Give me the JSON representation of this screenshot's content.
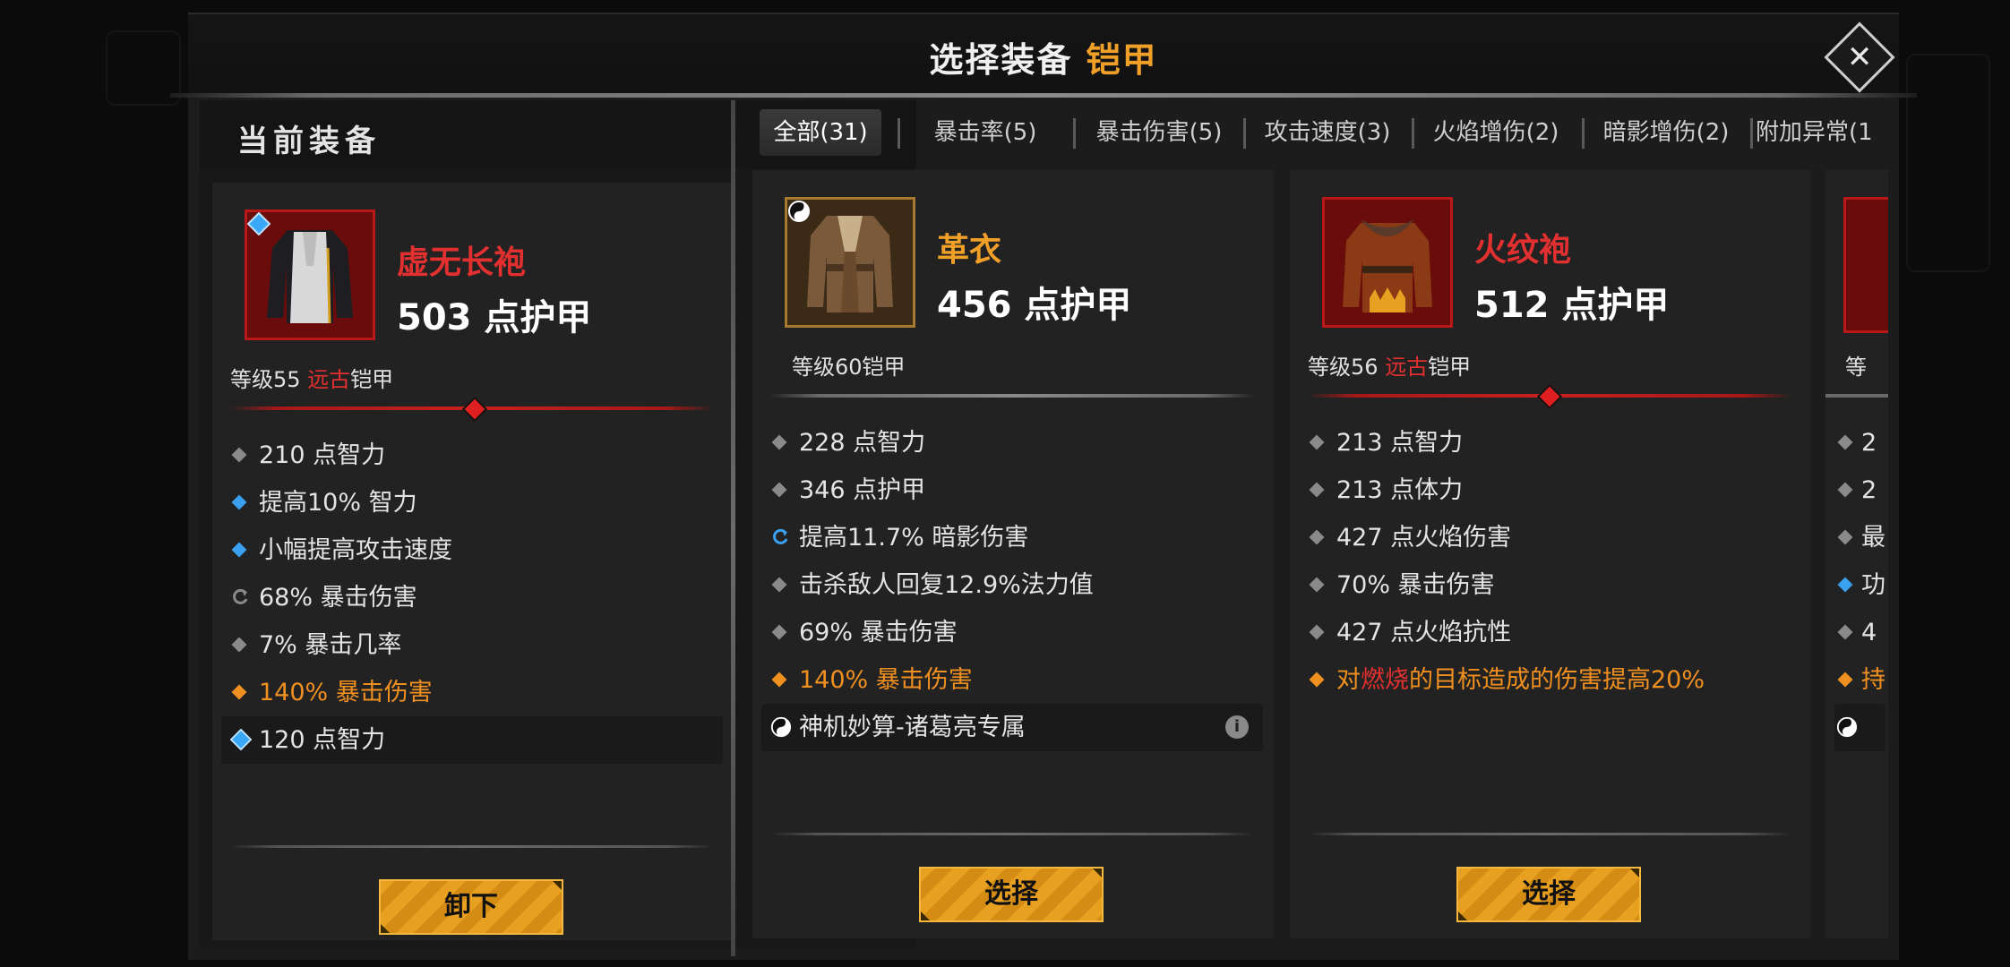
{
  "dialog": {
    "title_prefix": "选择装备",
    "title_category": "铠甲",
    "close_glyph": "✕"
  },
  "left": {
    "section_title": "当前装备",
    "item": {
      "name": "虚无长袍",
      "armor": "503 点护甲",
      "level_prefix": "等级55",
      "quality": "远古",
      "slot": "铠甲",
      "icon": "robe-white-icon",
      "socket_icon": "blue-gem-icon",
      "stats": [
        {
          "text": "210 点智力",
          "bullet": "gray"
        },
        {
          "text": "提高10% 智力",
          "bullet": "blue"
        },
        {
          "text": "小幅提高攻击速度",
          "bullet": "blue"
        },
        {
          "text": "68% 暴击伤害",
          "bullet": "reroll"
        },
        {
          "text": "7% 暴击几率",
          "bullet": "gray"
        },
        {
          "text": "140% 暴击伤害",
          "bullet": "orange"
        },
        {
          "text": "120 点智力",
          "bullet": "gem"
        }
      ],
      "button": "卸下"
    }
  },
  "tabs": [
    {
      "label": "全部(31)",
      "active": true
    },
    {
      "label": "暴击率(5)"
    },
    {
      "label": "暴击伤害(5)"
    },
    {
      "label": "攻击速度(3)"
    },
    {
      "label": "火焰增伤(2)"
    },
    {
      "label": "暗影增伤(2)"
    },
    {
      "label": "附加异常(1"
    }
  ],
  "candidates": [
    {
      "name": "革衣",
      "armor": "456 点护甲",
      "level_prefix": "等级60",
      "quality": "",
      "slot": "铠甲",
      "icon": "leather-coat-icon",
      "stats": [
        {
          "text": "228 点智力",
          "bullet": "gray"
        },
        {
          "text": "346 点护甲",
          "bullet": "gray"
        },
        {
          "text": "提高11.7% 暗影伤害",
          "bullet": "blue-reroll"
        },
        {
          "text": "击杀敌人回复12.9%法力值",
          "bullet": "gray"
        },
        {
          "text": "69% 暴击伤害",
          "bullet": "gray"
        },
        {
          "text": "140% 暴击伤害",
          "bullet": "orange"
        },
        {
          "text": "神机妙算-诸葛亮专属",
          "bullet": "yinyang"
        }
      ],
      "info_glyph": "i",
      "button": "选择"
    },
    {
      "name": "火纹袍",
      "armor": "512 点护甲",
      "level_prefix": "等级56",
      "quality": "远古",
      "slot": "铠甲",
      "icon": "fire-robe-icon",
      "stats": [
        {
          "text": "213 点智力",
          "bullet": "gray"
        },
        {
          "text": "213 点体力",
          "bullet": "gray"
        },
        {
          "text": "427 点火焰伤害",
          "bullet": "gray"
        },
        {
          "text": "70% 暴击伤害",
          "bullet": "gray"
        },
        {
          "text": "427 点火焰抗性",
          "bullet": "gray"
        },
        {
          "text_pre": "对",
          "text_hl": "燃烧",
          "text_post": "的目标造成的伤害提高20%",
          "bullet": "orange"
        }
      ],
      "button": "选择"
    }
  ],
  "partial_card": {
    "level_fragment": "等",
    "stat_fragments": [
      "2",
      "2",
      "最",
      "功",
      "4",
      "持"
    ]
  }
}
